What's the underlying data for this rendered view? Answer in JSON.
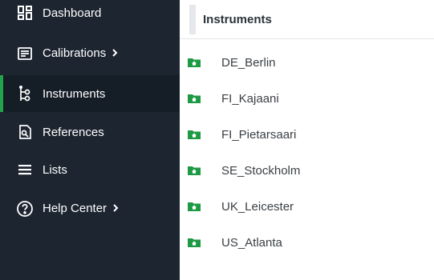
{
  "sidebar": {
    "items": [
      {
        "label": "Dashboard",
        "icon": "dashboard-icon",
        "active": false,
        "chevron": false
      },
      {
        "label": "Calibrations",
        "icon": "calibrations-icon",
        "active": false,
        "chevron": true
      },
      {
        "label": "Instruments",
        "icon": "instruments-icon",
        "active": true,
        "chevron": false
      },
      {
        "label": "References",
        "icon": "references-icon",
        "active": false,
        "chevron": false
      },
      {
        "label": "Lists",
        "icon": "list-icon",
        "active": false,
        "chevron": false
      },
      {
        "label": "Help Center",
        "icon": "help-icon",
        "active": false,
        "chevron": true
      }
    ]
  },
  "main": {
    "title": "Instruments",
    "instruments": [
      {
        "label": "DE_Berlin",
        "icon": "folder-home-icon"
      },
      {
        "label": "FI_Kajaani",
        "icon": "folder-home-icon"
      },
      {
        "label": "FI_Pietarsaari",
        "icon": "folder-home-icon"
      },
      {
        "label": "SE_Stockholm",
        "icon": "folder-home-icon"
      },
      {
        "label": "UK_Leicester",
        "icon": "folder-home-icon"
      },
      {
        "label": "US_Atlanta",
        "icon": "folder-home-icon"
      }
    ]
  },
  "colors": {
    "sidebar_bg": "#1c2530",
    "active_accent": "#22a24a",
    "folder_green": "#1e9a45"
  }
}
